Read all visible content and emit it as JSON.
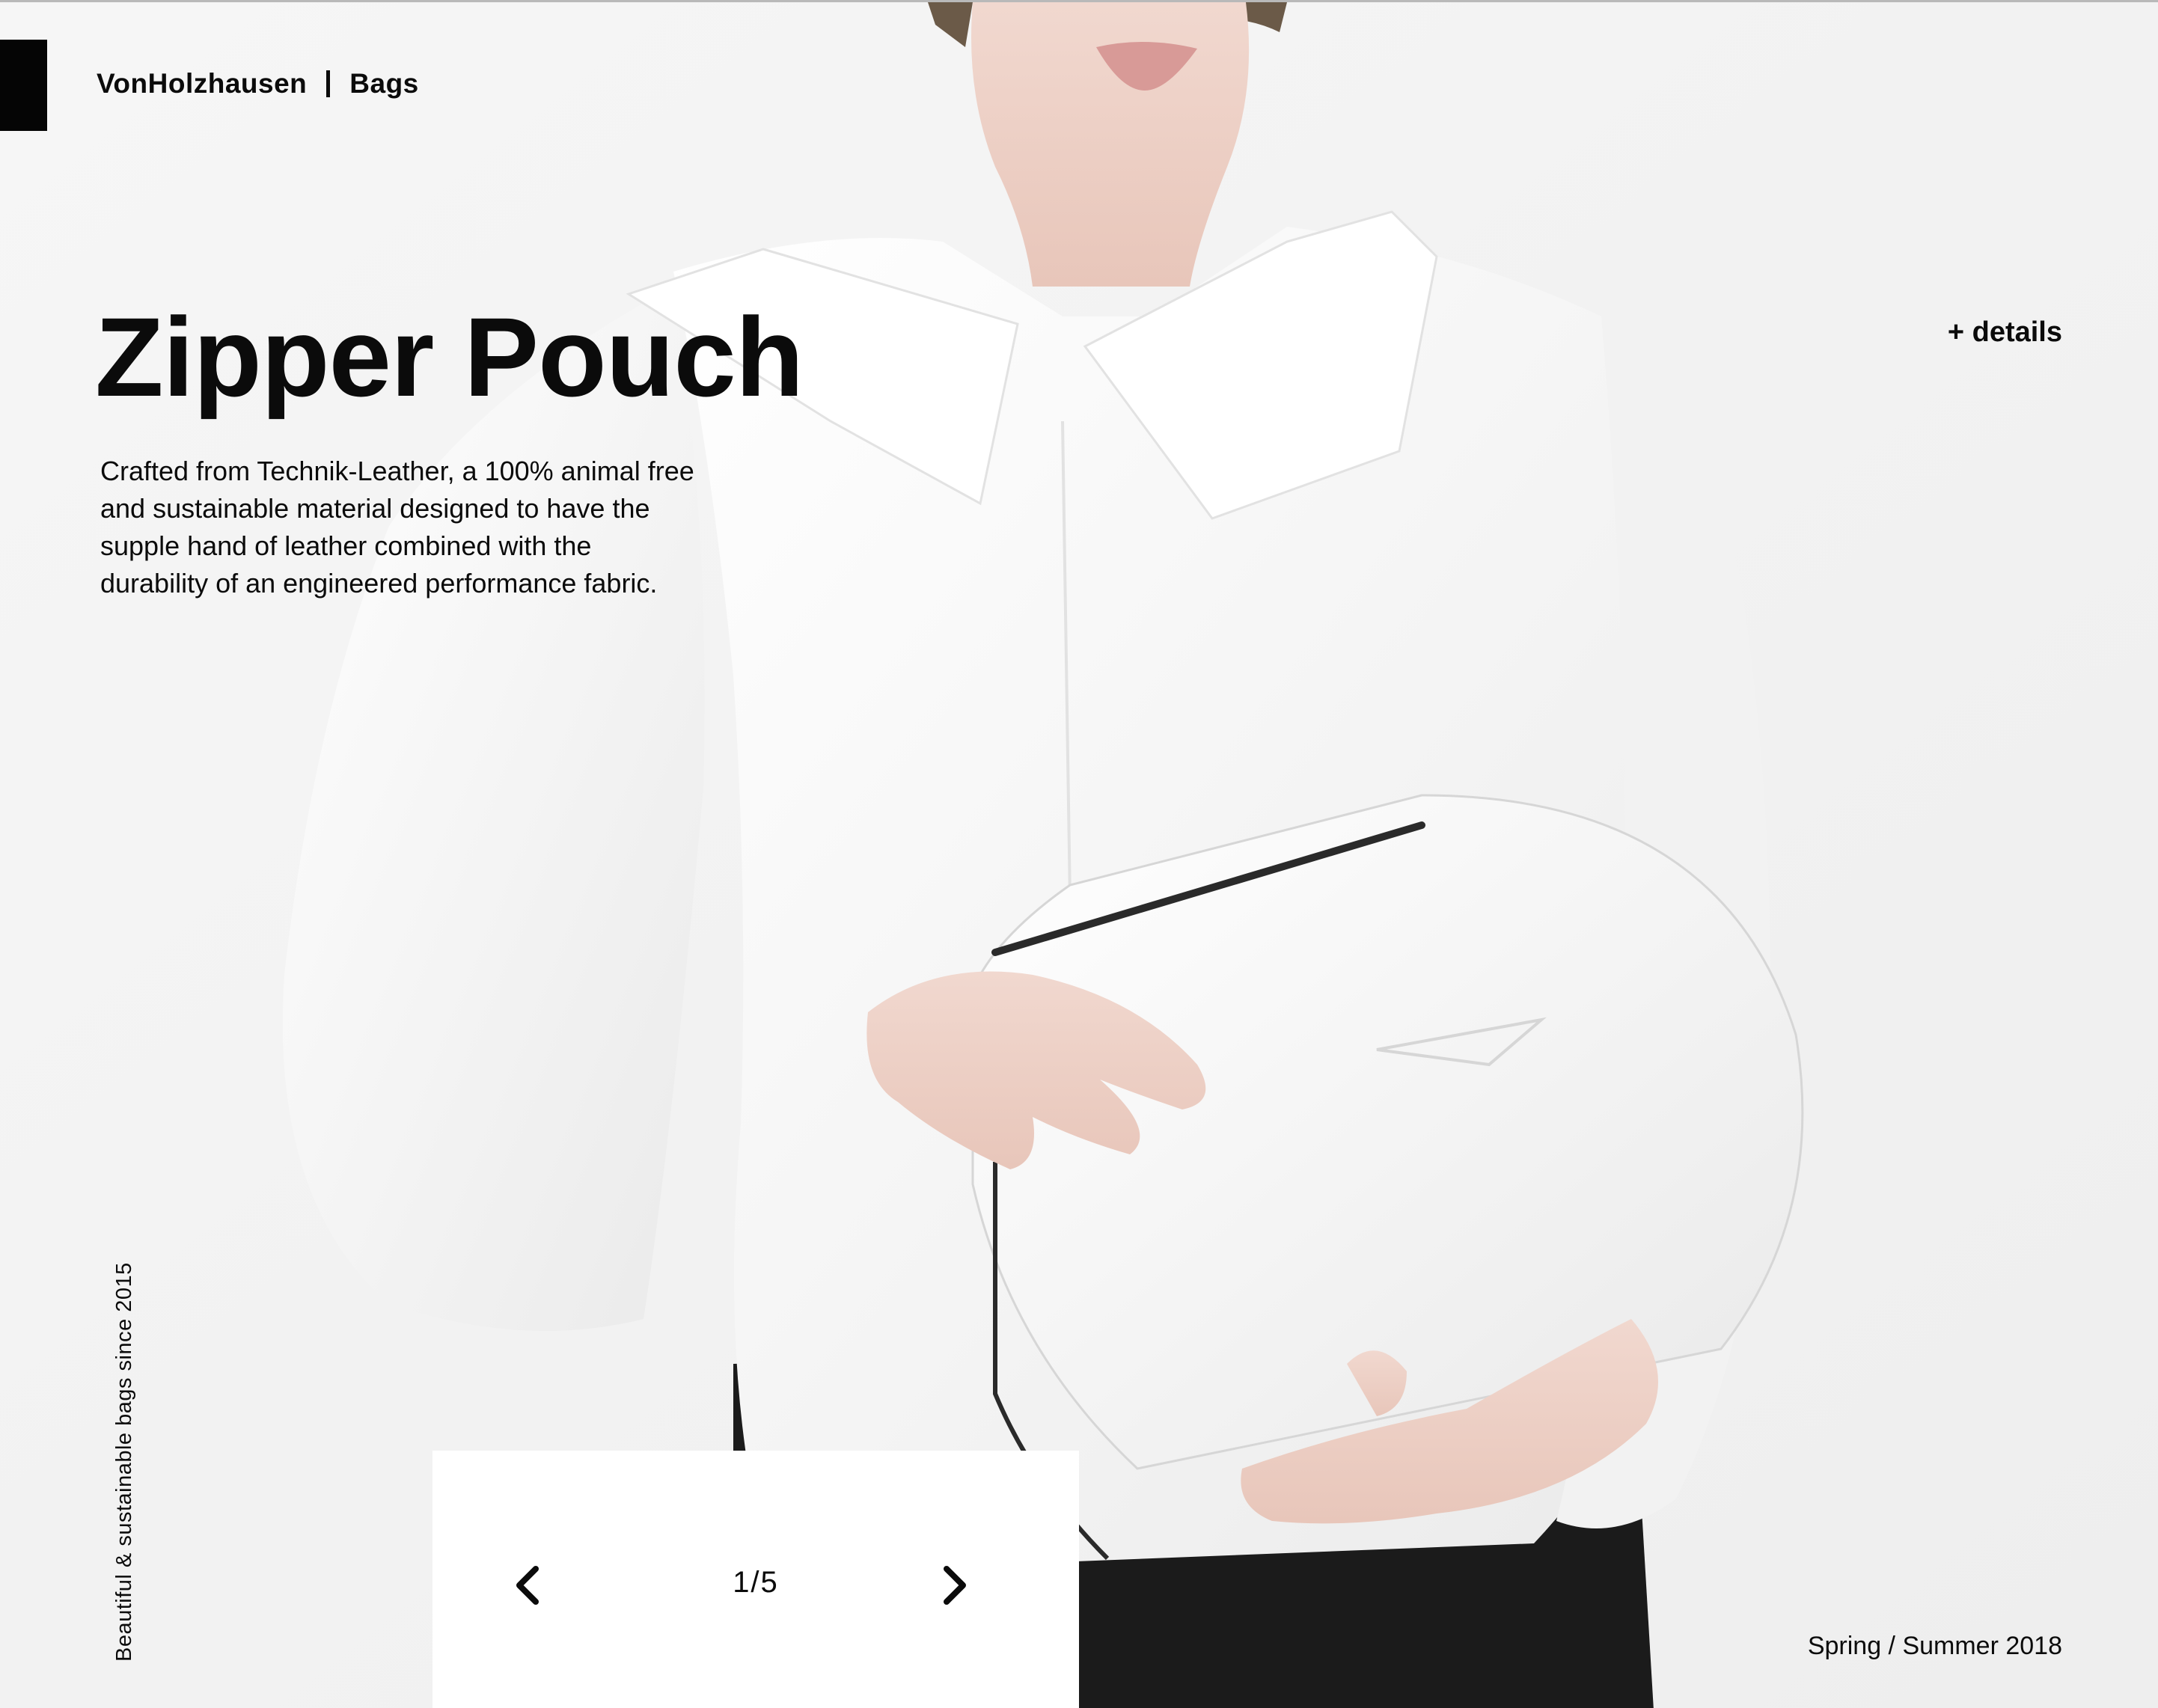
{
  "header": {
    "brand": "VonHolzhausen",
    "section": "Bags"
  },
  "product": {
    "title": "Zipper Pouch",
    "description": "Crafted from Technik-Leather, a 100% animal free and sustainable material designed to have the supple hand of leather combined with the durability of an engineered performance fabric.",
    "details_link": "+ details"
  },
  "sidebar": {
    "tagline": "Beautiful & sustainable bags since 2015"
  },
  "footer": {
    "season": "Spring / Summer 2018"
  },
  "slider": {
    "counter": "1/5",
    "current": 1,
    "total": 5,
    "prev_icon": "chevron-left-icon",
    "next_icon": "chevron-right-icon"
  },
  "colors": {
    "background": "#f2f2f2",
    "text": "#0b0b0b",
    "panel": "#ffffff"
  }
}
